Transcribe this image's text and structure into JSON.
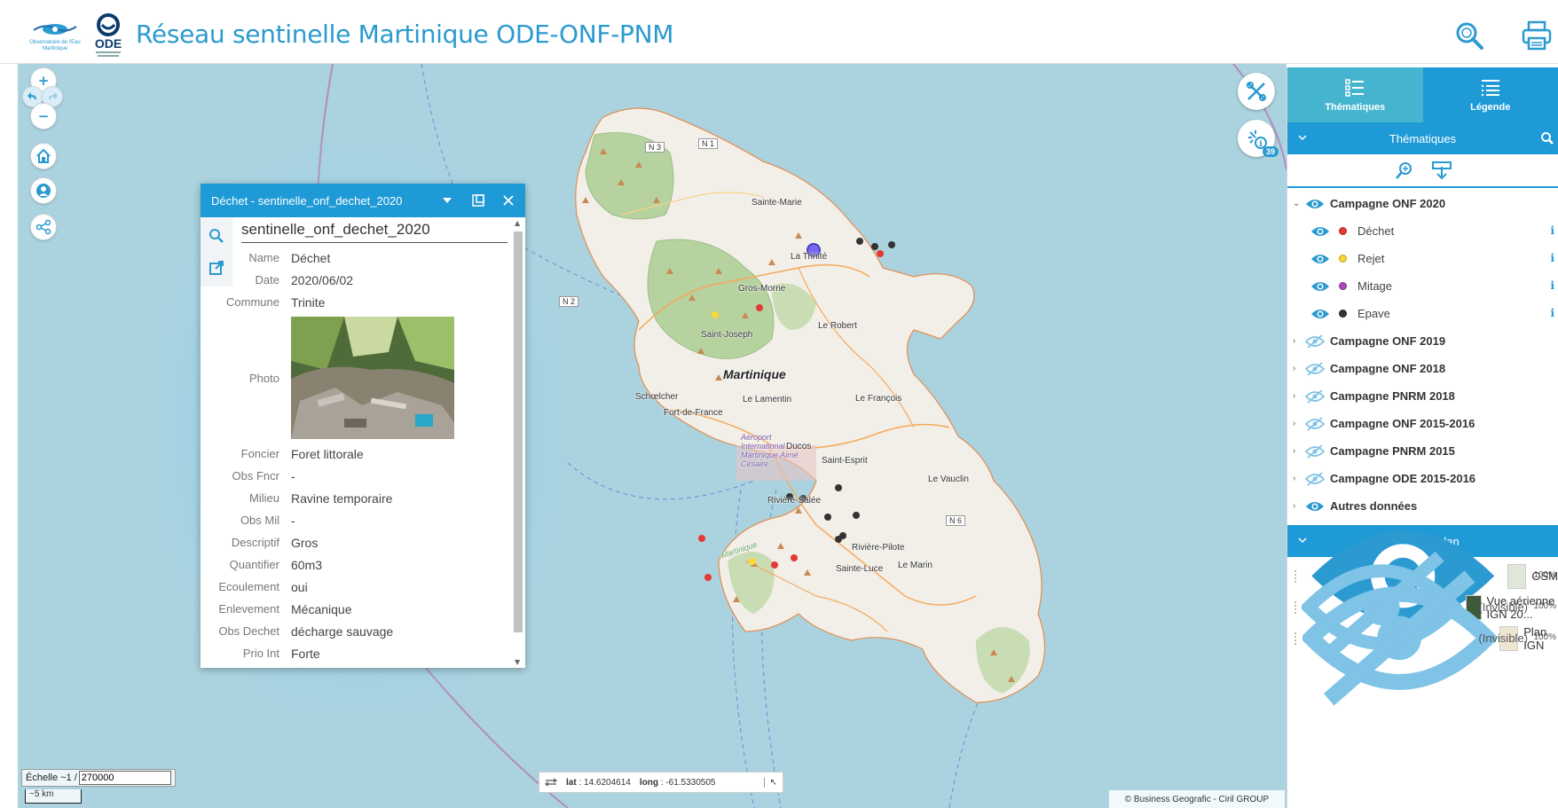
{
  "header": {
    "title": "Réseau sentinelle Martinique ODE-ONF-PNM",
    "logo_oe_line1": "Observatoire de l'Eau",
    "logo_oe_line2": "Martinique",
    "logo_ode_text": "ODE",
    "search_icon": "search-icon",
    "print_icon": "print-icon"
  },
  "map": {
    "controls": [
      "zoom-in",
      "undo",
      "redo",
      "zoom-out",
      "home",
      "geolocate",
      "share"
    ],
    "zoom_in": "+",
    "zoom_out": "−",
    "badge_count": "39",
    "place_labels": {
      "sainte_marie": "Sainte-Marie",
      "la_trinite": "La Trinité",
      "gros_morne": "Gros-Morne",
      "saint_joseph": "Saint-Joseph",
      "le_robert": "Le Robert",
      "martinique": "Martinique",
      "schoelcher": "Schœlcher",
      "fort_de_france": "Fort-de-France",
      "le_lamentin": "Le Lamentin",
      "le_francois": "Le François",
      "aeroport": "Aéroport International Martinique Aimé Césaire",
      "ducos": "Ducos",
      "saint_esprit": "Saint-Esprit",
      "le_vauclin": "Le Vauclin",
      "riviere_salee": "Rivière-Salée",
      "riviere_pilote": "Rivière-Pilote",
      "sainte_luce": "Sainte-Luce",
      "le_marin": "Le Marin",
      "martinique_small": "Martinique"
    },
    "roads": {
      "n3": "N 3",
      "n1": "N 1",
      "n2": "N 2",
      "n6": "N 6"
    },
    "scale_label": "Échelle ~1 /",
    "scale_value": "270000",
    "scale_bar": "~5 km",
    "lat_label": "lat",
    "lat_value": "14.6204614",
    "long_label": "long",
    "long_value": "-61.5330505",
    "attribution": "© Business Geografic - Ciril GROUP"
  },
  "popup": {
    "title": "Déchet - sentinelle_onf_dechet_2020",
    "layer_name": "sentinelle_onf_dechet_2020",
    "attributes": [
      {
        "key": "Name",
        "value": "Déchet"
      },
      {
        "key": "Date",
        "value": "2020/06/02"
      },
      {
        "key": "Commune",
        "value": "Trinite"
      },
      {
        "key": "Photo",
        "value": ""
      },
      {
        "key": "Foncier",
        "value": "Foret littorale"
      },
      {
        "key": "Obs Fncr",
        "value": "-"
      },
      {
        "key": "Milieu",
        "value": "Ravine temporaire"
      },
      {
        "key": "Obs Mil",
        "value": "-"
      },
      {
        "key": "Descriptif",
        "value": "Gros"
      },
      {
        "key": "Quantifier",
        "value": "60m3"
      },
      {
        "key": "Ecoulement",
        "value": "oui"
      },
      {
        "key": "Enlevement",
        "value": "Mécanique"
      },
      {
        "key": "Obs Dechet",
        "value": "décharge sauvage"
      },
      {
        "key": "Prio Int",
        "value": "Forte"
      }
    ]
  },
  "panel": {
    "tab_thematiques": "Thématiques",
    "tab_legende": "Légende",
    "section_thematiques": "Thématiques",
    "section_fonds": "Fonds de plan",
    "campaign_2020": "Campagne ONF 2020",
    "layers_2020": [
      {
        "label": "Déchet",
        "color": "#e53935"
      },
      {
        "label": "Rejet",
        "color": "#fdd835"
      },
      {
        "label": "Mitage",
        "color": "#ab47bc"
      },
      {
        "label": "Epave",
        "color": "#333333"
      }
    ],
    "info_glyph": "i",
    "groups": [
      {
        "label": "Campagne ONF 2019",
        "visible": false
      },
      {
        "label": "Campagne ONF 2018",
        "visible": false
      },
      {
        "label": "Campagne PNRM 2018",
        "visible": false
      },
      {
        "label": "Campagne ONF 2015-2016",
        "visible": false
      },
      {
        "label": "Campagne PNRM 2015",
        "visible": false
      },
      {
        "label": "Campagne ODE 2015-2016",
        "visible": false
      },
      {
        "label": "Autres données",
        "visible": true
      }
    ],
    "base_layers": [
      {
        "label": "OSM",
        "status": "",
        "opacity": "100%",
        "visible": true
      },
      {
        "label": "Vue aérienne IGN 20...",
        "status": "(Invisible)",
        "opacity": "100%",
        "visible": false
      },
      {
        "label": "Plan IGN",
        "status": "(Invisible)",
        "opacity": "100%",
        "visible": false
      }
    ]
  },
  "colors": {
    "brand_blue": "#1e9ad6",
    "tab_teal": "#45b5cf",
    "sea": "#aad3df",
    "land": "#f2efe9",
    "forest": "#b5d29f"
  }
}
